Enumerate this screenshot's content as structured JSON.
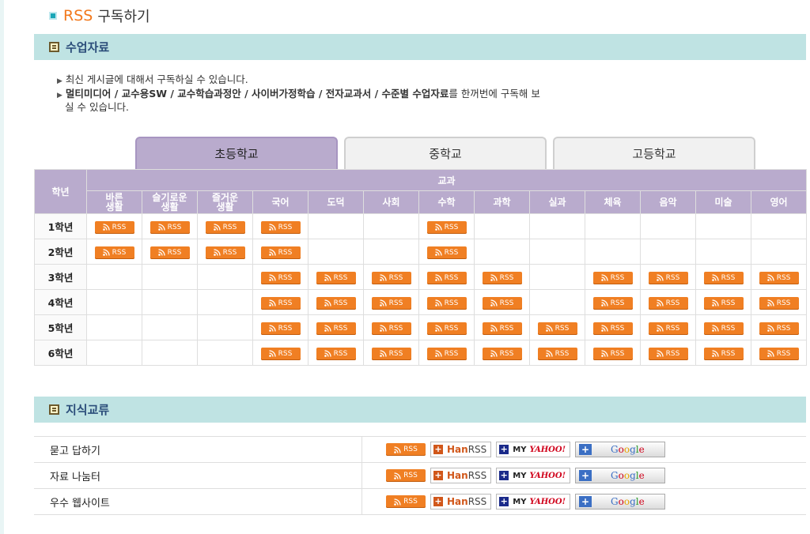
{
  "page": {
    "title_rss": "RSS",
    "title_rest": "구독하기"
  },
  "section1": {
    "title": "수업자료",
    "desc_line1": "최신 게시글에 대해서 구독하실 수 있습니다.",
    "desc_line2_bold": "멀티미디어 / 교수용SW / 교수학습과정안 / 사이버가정학습 / 전자교과서 / 수준별 수업자료",
    "desc_line2_rest": "를 한꺼번에 구독해 보",
    "desc_line3": "실 수 있습니다."
  },
  "tabs": [
    {
      "label": "초등학교",
      "active": true
    },
    {
      "label": "중학교",
      "active": false
    },
    {
      "label": "고등학교",
      "active": false
    }
  ],
  "grid": {
    "grade_header": "학년",
    "subject_group_header": "교과",
    "subjects": [
      "바른\n생활",
      "슬기로운\n생활",
      "즐거운\n생활",
      "국어",
      "도덕",
      "사회",
      "수학",
      "과학",
      "실과",
      "체육",
      "음악",
      "미술",
      "영어"
    ],
    "rss_label": "RSS",
    "rows": [
      {
        "grade": "1학년",
        "cells": [
          1,
          1,
          1,
          1,
          0,
          0,
          1,
          0,
          0,
          0,
          0,
          0,
          0
        ]
      },
      {
        "grade": "2학년",
        "cells": [
          1,
          1,
          1,
          1,
          0,
          0,
          1,
          0,
          0,
          0,
          0,
          0,
          0
        ]
      },
      {
        "grade": "3학년",
        "cells": [
          0,
          0,
          0,
          1,
          1,
          1,
          1,
          1,
          0,
          1,
          1,
          1,
          1
        ]
      },
      {
        "grade": "4학년",
        "cells": [
          0,
          0,
          0,
          1,
          1,
          1,
          1,
          1,
          0,
          1,
          1,
          1,
          1
        ]
      },
      {
        "grade": "5학년",
        "cells": [
          0,
          0,
          0,
          1,
          1,
          1,
          1,
          1,
          1,
          1,
          1,
          1,
          1
        ]
      },
      {
        "grade": "6학년",
        "cells": [
          0,
          0,
          0,
          1,
          1,
          1,
          1,
          1,
          1,
          1,
          1,
          1,
          1
        ]
      }
    ]
  },
  "section2": {
    "title": "지식교류",
    "rows": [
      {
        "label": "묻고 답하기"
      },
      {
        "label": "자료 나눔터"
      },
      {
        "label": "우수 웹사이트"
      }
    ],
    "buttons": {
      "rss": "RSS",
      "hanrss_han": "Han",
      "hanrss_rss": "RSS",
      "yahoo_my": "MY",
      "yahoo_name": "YAHOO!",
      "google": "Google"
    }
  },
  "colors": {
    "accent_rss": "#f07f23",
    "tab_active": "#b9abcd",
    "section_bar": "#bfe3e3"
  }
}
